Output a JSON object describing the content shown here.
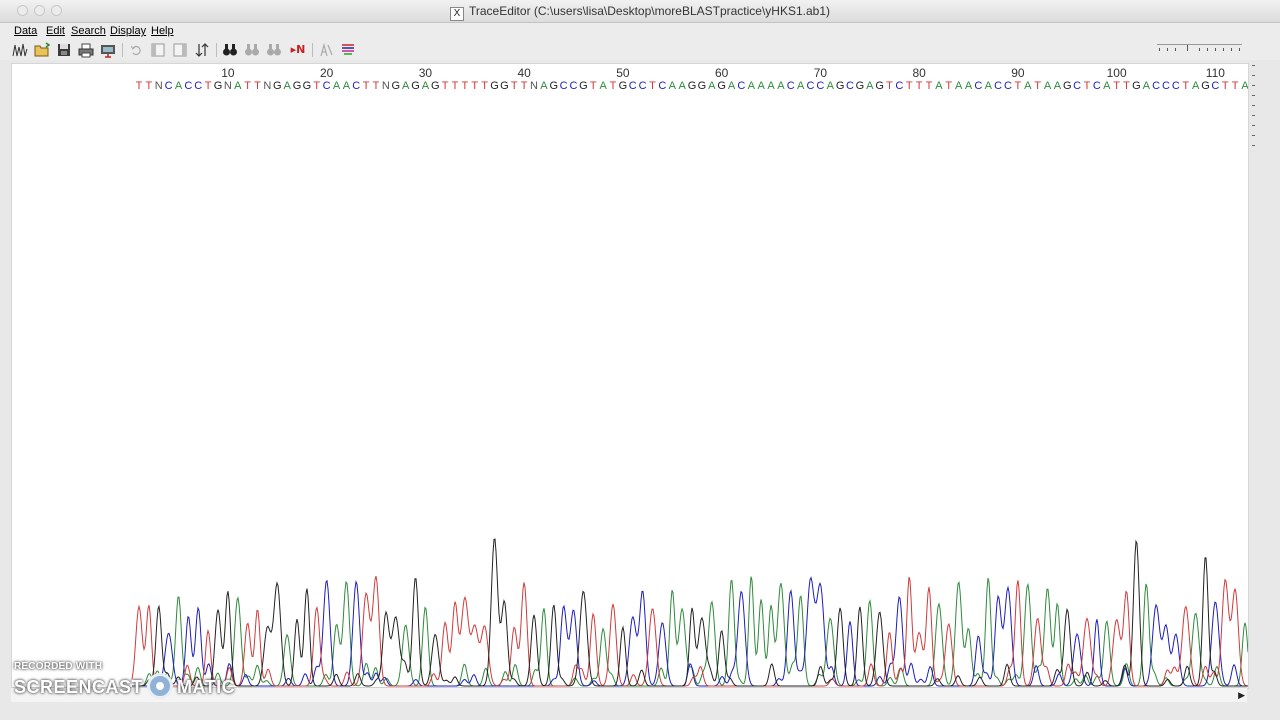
{
  "window": {
    "title": "TraceEditor (C:\\users\\lisa\\Desktop\\moreBLASTpractice\\yHKS1.ab1)",
    "title_icon": "X"
  },
  "menu": {
    "items": [
      "Data",
      "Edit",
      "Search",
      "Display",
      "Help"
    ]
  },
  "toolbar": {
    "icons": [
      "trace-icon",
      "open-folder-icon",
      "save-disk-icon",
      "print-icon",
      "export-icon",
      "undo-icon",
      "left-trim-icon",
      "right-trim-icon",
      "sort-icon",
      "find-icon",
      "find-next-icon",
      "find-previous-icon",
      "next-n-icon",
      "edit-base-icon",
      "color-lines-icon"
    ],
    "next_n_label": "▸N"
  },
  "colors": {
    "A": "#2e8b3a",
    "C": "#1d1dbf",
    "G": "#222222",
    "T": "#d23a3a",
    "N": "#555555",
    "ruler": "#333333"
  },
  "sequence": {
    "positions": [
      "10",
      "20",
      "30",
      "40",
      "50",
      "60",
      "70",
      "80",
      "90",
      "100",
      "110"
    ],
    "bases": "TTNCACCTGNATTNGAGGTCAACTTNGAGAGTTTTTGGTTNAGCCGTATGCCTCAAGGAGACAAAACACCAGCGAGTCTTTATAACACCTATAAGCTCATTGACCCTAGCTTA"
  },
  "watermark": {
    "line1": "RECORDED WITH",
    "line2_left": "SCREENCAST",
    "line2_right": "MATIC"
  }
}
